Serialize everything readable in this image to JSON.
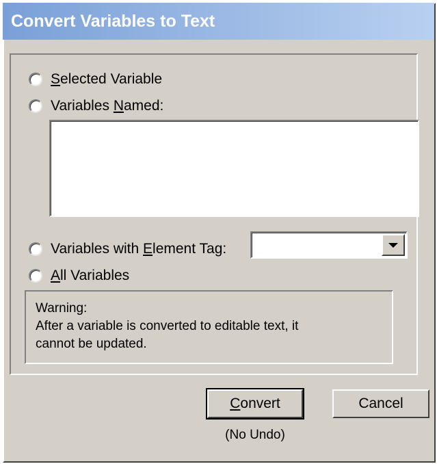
{
  "dialog": {
    "title": "Convert Variables to Text"
  },
  "options": [
    {
      "id": "selected",
      "pre": "",
      "accel": "S",
      "post": "elected Variable",
      "checked": false
    },
    {
      "id": "named",
      "pre": "Variables ",
      "accel": "N",
      "post": "amed:",
      "checked": false
    },
    {
      "id": "element-tag",
      "pre": "Variables with ",
      "accel": "E",
      "post": "lement Tag:",
      "checked": false
    },
    {
      "id": "all",
      "pre": "",
      "accel": "A",
      "post": "ll Variables",
      "checked": false
    }
  ],
  "names_list": {
    "items": []
  },
  "element_tag_combo": {
    "value": "",
    "icon": "chevron-down-icon"
  },
  "warning": {
    "heading": "Warning:",
    "line1": "After a variable is converted to editable text, it",
    "line2": "cannot be updated."
  },
  "buttons": {
    "convert_accel": "C",
    "convert_rest": "onvert",
    "cancel": "Cancel"
  },
  "footer": {
    "no_undo": "(No Undo)"
  },
  "colors": {
    "face": "#d4d0c8",
    "title_gradient_start": "#7aa0d8",
    "title_gradient_end": "#b8d0f0",
    "title_text": "#ffffff"
  }
}
